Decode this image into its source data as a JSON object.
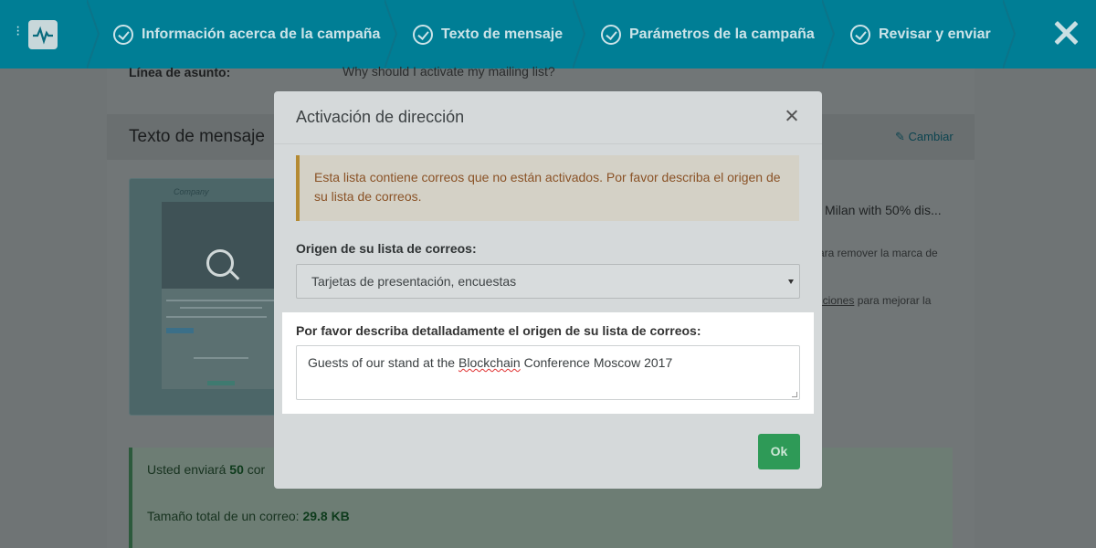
{
  "wizard": {
    "steps": [
      {
        "label": "Información acerca de la campaña"
      },
      {
        "label": "Texto de mensaje"
      },
      {
        "label": "Parámetros de la campaña"
      },
      {
        "label": "Revisar y enviar"
      }
    ]
  },
  "background": {
    "subject_label": "Línea de asunto:",
    "subject_value": "Why should I activate my mailing list?",
    "section_title": "Texto de mensaje",
    "change_link": "Cambiar",
    "preview_brand": "Company",
    "side_line1": "Milan with 50% dis...",
    "side_line2": "ara remover la marca de",
    "side_line3_link": "iciones",
    "side_line3_rest": " para mejorar la",
    "summary_prefix": "Usted enviará ",
    "summary_count": "50",
    "summary_suffix": " cor",
    "size_label": "Tamaño total de un correo: ",
    "size_value": "29.8 KB"
  },
  "modal": {
    "title": "Activación de dirección",
    "alert_text": "Esta lista contiene correos que no están activados. Por favor describa el origen de su lista de correos.",
    "origin_label": "Origen de su lista de correos:",
    "origin_selected": "Tarjetas de presentación, encuestas",
    "describe_label": "Por favor describa detalladamente el origen de su lista de correos:",
    "describe_value_before": "Guests of our stand at the ",
    "describe_value_spell": "Blockchain",
    "describe_value_after": " Conference Moscow 2017",
    "ok_label": "Ok"
  },
  "colors": {
    "topbar": "#007e95",
    "ok_button": "#2e9a57",
    "alert_border": "#b48a33"
  }
}
